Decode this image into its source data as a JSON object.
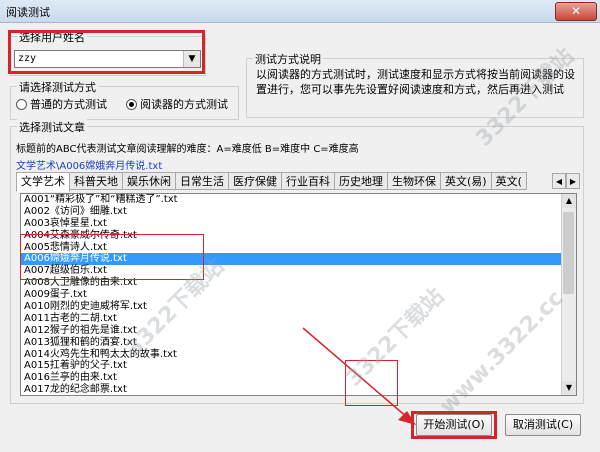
{
  "window": {
    "title": "阅读测试",
    "close_glyph": "✕"
  },
  "user": {
    "group_label": "选择用户姓名",
    "value": "zzy",
    "dropdown_glyph": "▼"
  },
  "mode": {
    "group_label": "请选择测试方式",
    "options": [
      {
        "label": "普通的方式测试",
        "selected": false
      },
      {
        "label": "阅读器的方式测试",
        "selected": true
      }
    ]
  },
  "description": {
    "group_label": "测试方式说明",
    "text": "以阅读器的方式测试时，测试速度和显示方式将按当前阅读器的设置进行，您可以事先先设置好阅读速度和方式，然后再进入测试"
  },
  "articles": {
    "group_label": "选择测试文章",
    "hint": "标题前的ABC代表测试文章阅读理解的难度：A=难度低 B=难度中 C=难度高",
    "current_path": "文学艺术\\A006嫦娥奔月传说.txt",
    "tabs": [
      "文学艺术",
      "科普天地",
      "娱乐休闲",
      "日常生活",
      "医疗保健",
      "行业百科",
      "历史地理",
      "生物环保",
      "英文(易)",
      "英文("
    ],
    "tab_left_glyph": "◀",
    "tab_right_glyph": "▶",
    "items": [
      "A001“精彩极了”和“糟糕透了”.txt",
      "A002《访问》细雕.txt",
      "A003哀悼星星.txt",
      "A004艾森豪威尔传奇.txt",
      "A005悲情诗人.txt",
      "A006嫦娥奔月传说.txt",
      "A007超级伯乐.txt",
      "A008大卫雕像的由来.txt",
      "A009蛋子.txt",
      "A010刚烈的史迪威将军.txt",
      "A011古老的二胡.txt",
      "A012猴子的祖先是谁.txt",
      "A013狐狸和鹤的酒宴.txt",
      "A014火鸡先生和鸭太太的故事.txt",
      "A015扛着驴的父子.txt",
      "A016兰亭的由来.txt",
      "A017龙的纪念邮票.txt"
    ],
    "selected_index": 5,
    "scroll_up_glyph": "▲",
    "scroll_down_glyph": "▼"
  },
  "buttons": {
    "start": "开始测试(O)",
    "cancel": "取消测试(C)"
  },
  "watermarks": [
    "3322下载站",
    "www.3322.cc",
    "3322下载站",
    "3322下载站"
  ],
  "colors": {
    "highlight": "#d6252a",
    "selection": "#3399ff",
    "path_link": "#1a3fbf"
  }
}
